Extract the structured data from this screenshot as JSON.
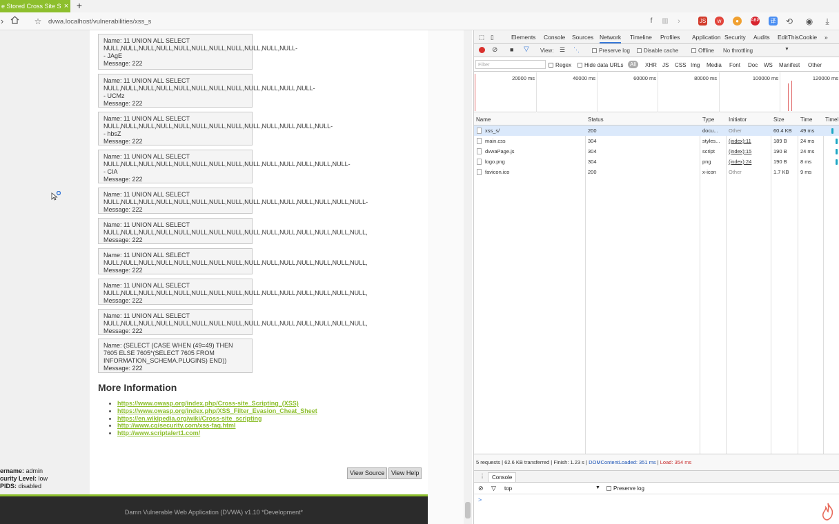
{
  "browser": {
    "tab_title": "e Stored Cross Site S",
    "url": "dvwa.localhost/vulnerabilities/xss_s"
  },
  "guestbook": [
    {
      "name": "Name: 11 UNION ALL SELECT\nNULL,NULL,NULL,NULL,NULL,NULL,NULL,NULL,NULL,NULL,NULL-\n- JAgE",
      "message": "Message: 222"
    },
    {
      "name": "Name: 11 UNION ALL SELECT\nNULL,NULL,NULL,NULL,NULL,NULL,NULL,NULL,NULL,NULL,NULL,NULL-\n- UCMz",
      "message": "Message: 222"
    },
    {
      "name": "Name: 11 UNION ALL SELECT\nNULL,NULL,NULL,NULL,NULL,NULL,NULL,NULL,NULL,NULL,NULL,NULL,NULL-\n- hbsZ",
      "message": "Message: 222"
    },
    {
      "name": "Name: 11 UNION ALL SELECT\nNULL,NULL,NULL,NULL,NULL,NULL,NULL,NULL,NULL,NULL,NULL,NULL,NULL,NULL-\n- CIA",
      "message": "Message: 222"
    },
    {
      "name": "Name: 11 UNION ALL SELECT\nNULL,NULL,NULL,NULL,NULL,NULL,NULL,NULL,NULL,NULL,NULL,NULL,NULL,NULL,NULL-",
      "message": "Message: 222"
    },
    {
      "name": "Name: 11 UNION ALL SELECT\nNULL,NULL,NULL,NULL,NULL,NULL,NULL,NULL,NULL,NULL,NULL,NULL,NULL,NULL,NULL,",
      "message": "Message: 222"
    },
    {
      "name": "Name: 11 UNION ALL SELECT\nNULL,NULL,NULL,NULL,NULL,NULL,NULL,NULL,NULL,NULL,NULL,NULL,NULL,NULL,NULL,",
      "message": "Message: 222"
    },
    {
      "name": "Name: 11 UNION ALL SELECT\nNULL,NULL,NULL,NULL,NULL,NULL,NULL,NULL,NULL,NULL,NULL,NULL,NULL,NULL,NULL,",
      "message": "Message: 222"
    },
    {
      "name": "Name: 11 UNION ALL SELECT\nNULL,NULL,NULL,NULL,NULL,NULL,NULL,NULL,NULL,NULL,NULL,NULL,NULL,NULL,NULL,",
      "message": "Message: 222"
    },
    {
      "name": "Name: (SELECT (CASE WHEN (49=49) THEN\n7605 ELSE 7605*(SELECT 7605 FROM\nINFORMATION_SCHEMA.PLUGINS) END))",
      "message": "Message: 222"
    }
  ],
  "more_info": {
    "title": "More Information",
    "links": [
      "https://www.owasp.org/index.php/Cross-site_Scripting_(XSS)",
      "https://www.owasp.org/index.php/XSS_Filter_Evasion_Cheat_Sheet",
      "https://en.wikipedia.org/wiki/Cross-site_scripting",
      "http://www.cgisecurity.com/xss-faq.html",
      "http://www.scriptalert1.com/"
    ]
  },
  "user_info": {
    "username_label": "ername:",
    "username": "admin",
    "security_label": "curity Level:",
    "security": "low",
    "phpids_label": "PIDS:",
    "phpids": "disabled"
  },
  "buttons": {
    "view_source": "View Source",
    "view_help": "View Help"
  },
  "footer": "Damn Vulnerable Web Application (DVWA) v1.10 *Development*",
  "devtools": {
    "tabs": [
      "Elements",
      "Console",
      "Sources",
      "Network",
      "Timeline",
      "Profiles",
      "Application",
      "Security",
      "Audits",
      "EditThisCookie"
    ],
    "toolbar": {
      "view": "View:",
      "preserve_log": "Preserve log",
      "disable_cache": "Disable cache",
      "offline": "Offline",
      "throttling": "No throttling"
    },
    "filter": {
      "placeholder": "Filter",
      "regex": "Regex",
      "hide_data": "Hide data URLs",
      "types": [
        "All",
        "XHR",
        "JS",
        "CSS",
        "Img",
        "Media",
        "Font",
        "Doc",
        "WS",
        "Manifest",
        "Other"
      ]
    },
    "overview_ticks": [
      "20000 ms",
      "40000 ms",
      "60000 ms",
      "80000 ms",
      "100000 ms",
      "120000 ms"
    ],
    "columns": [
      "Name",
      "Status",
      "Type",
      "Initiator",
      "Size",
      "Time",
      "Timel"
    ],
    "requests": [
      {
        "name": "xss_s/",
        "status": "200",
        "type": "docu...",
        "initiator": "Other",
        "size": "60.4 KB",
        "time": "49 ms"
      },
      {
        "name": "main.css",
        "status": "304",
        "type": "styles...",
        "initiator": "(index):11",
        "size": "189 B",
        "time": "24 ms"
      },
      {
        "name": "dvwaPage.js",
        "status": "304",
        "type": "script",
        "initiator": "(index):15",
        "size": "190 B",
        "time": "24 ms"
      },
      {
        "name": "logo.png",
        "status": "304",
        "type": "png",
        "initiator": "(index):24",
        "size": "190 B",
        "time": "8 ms"
      },
      {
        "name": "favicon.ico",
        "status": "200",
        "type": "x-icon",
        "initiator": "Other",
        "size": "1.7 KB",
        "time": "9 ms"
      }
    ],
    "summary": {
      "requests": "5 requests",
      "transferred": "62.6 KB transferred",
      "finish": "Finish: 1.23 s",
      "dcl": "DOMContentLoaded: 351 ms",
      "load": "Load: 354 ms"
    },
    "console": {
      "tab": "Console",
      "context": "top",
      "preserve_log": "Preserve log",
      "prompt": ">"
    }
  },
  "colors": {
    "accent": "#8dbf2d",
    "devtools_blue": "#3879d9",
    "footer_bg": "#2b2b2b"
  }
}
